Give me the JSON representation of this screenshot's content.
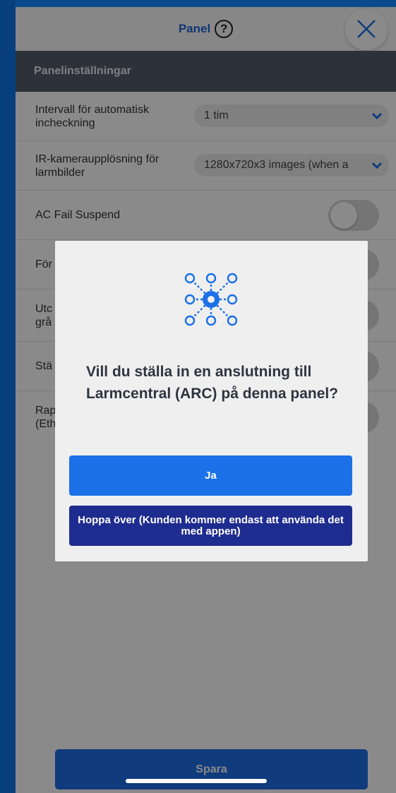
{
  "header": {
    "title": "Panel",
    "help_glyph": "?",
    "close_icon": "close-icon"
  },
  "section": {
    "title": "Panelinställningar"
  },
  "settings": [
    {
      "label": "Intervall för automatisk incheckning",
      "value": "1 tim"
    },
    {
      "label": "IR-kameraupplösning för larmbilder",
      "value": "1280x720x3 images (when a"
    },
    {
      "label": "AC Fail Suspend"
    },
    {
      "label": "För"
    },
    {
      "label": "Utc grå"
    },
    {
      "label": "Stä"
    },
    {
      "label": "Rap (Eth"
    }
  ],
  "dialog": {
    "icon": "network-hub-icon",
    "message": "Vill du ställa in en anslutning till Larmcentral (ARC) på denna panel?",
    "yes_label": "Ja",
    "skip_label": "Hoppa över (Kunden kommer endast att använda det med appen)"
  },
  "footer": {
    "save_label": "Spara"
  },
  "colors": {
    "accent": "#1c70e8",
    "skip": "#1f2c8f",
    "header_bar": "#545b69"
  }
}
